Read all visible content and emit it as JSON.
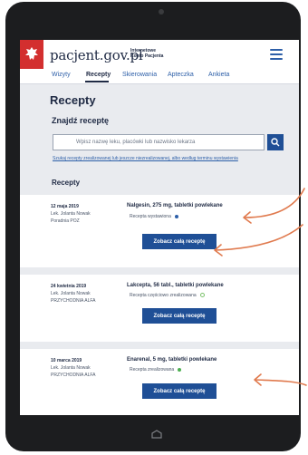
{
  "header": {
    "brand": "pacjent.gov.pl",
    "subtitle_line1": "Internetowe",
    "subtitle_line2": "Konto Pacjenta"
  },
  "tabs": [
    {
      "label": "Wizyty"
    },
    {
      "label": "Recepty"
    },
    {
      "label": "Skierowania"
    },
    {
      "label": "Apteczka"
    },
    {
      "label": "Ankieta"
    }
  ],
  "page": {
    "title": "Recepty",
    "find_label": "Znajdź receptę",
    "search_placeholder": "Wpisz nazwę leku, placówki lub nazwisko lekarza",
    "advanced_link": "Szukaj recepty zrealizowanej lub jeszcze niezrealizowanej, albo według terminu wystawienia",
    "list_title": "Recepty"
  },
  "colors": {
    "status_issued": "#2d5fa8",
    "status_partial": "#7bc16b",
    "status_done": "#4caf50"
  },
  "prescriptions": [
    {
      "date": "12 maja 2019",
      "doctor": "Lek. Jolanta Nowak",
      "clinic": "Poradnia POZ",
      "drug": "Nalgesin, 275 mg, tabletki powlekane",
      "status": "Recepta wystawiona",
      "button": "Zobacz całą receptę"
    },
    {
      "date": "24 kwietnia 2019",
      "doctor": "Lek. Jolanta Nowak",
      "clinic": "PRZYCHODNIA ALFA",
      "drug": "Lakcepta, 56 tabl., tabletki powlekane",
      "status": "Recepta częściowo zrealizowana",
      "button": "Zobacz całą receptę"
    },
    {
      "date": "10 marca 2019",
      "doctor": "Lek. Jolanta Nowak",
      "clinic": "PRZYCHODNIA ALFA",
      "drug": "Enarenal, 5 mg, tabletki powlekane",
      "status": "Recepta zrealizowana",
      "button": "Zobacz całą receptę"
    }
  ]
}
